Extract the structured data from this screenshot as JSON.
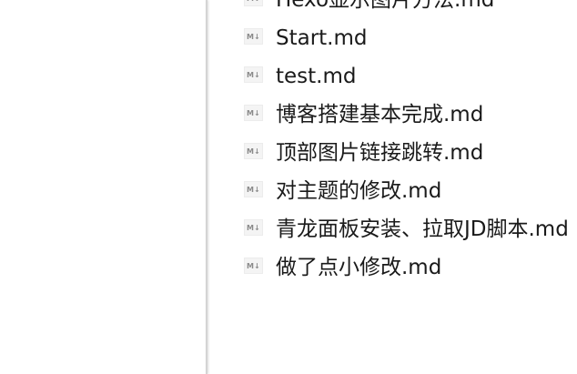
{
  "file_list": {
    "items": [
      {
        "icon": "markdown-file-icon",
        "name": "Hexo显示图片方法.md"
      },
      {
        "icon": "markdown-file-icon",
        "name": "Start.md"
      },
      {
        "icon": "markdown-file-icon",
        "name": "test.md"
      },
      {
        "icon": "markdown-file-icon",
        "name": "博客搭建基本完成.md"
      },
      {
        "icon": "markdown-file-icon",
        "name": "顶部图片链接跳转.md"
      },
      {
        "icon": "markdown-file-icon",
        "name": "对主题的修改.md"
      },
      {
        "icon": "markdown-file-icon",
        "name": "青龙面板安装、拉取JD脚本.md"
      },
      {
        "icon": "markdown-file-icon",
        "name": "做了点小修改.md"
      }
    ]
  }
}
